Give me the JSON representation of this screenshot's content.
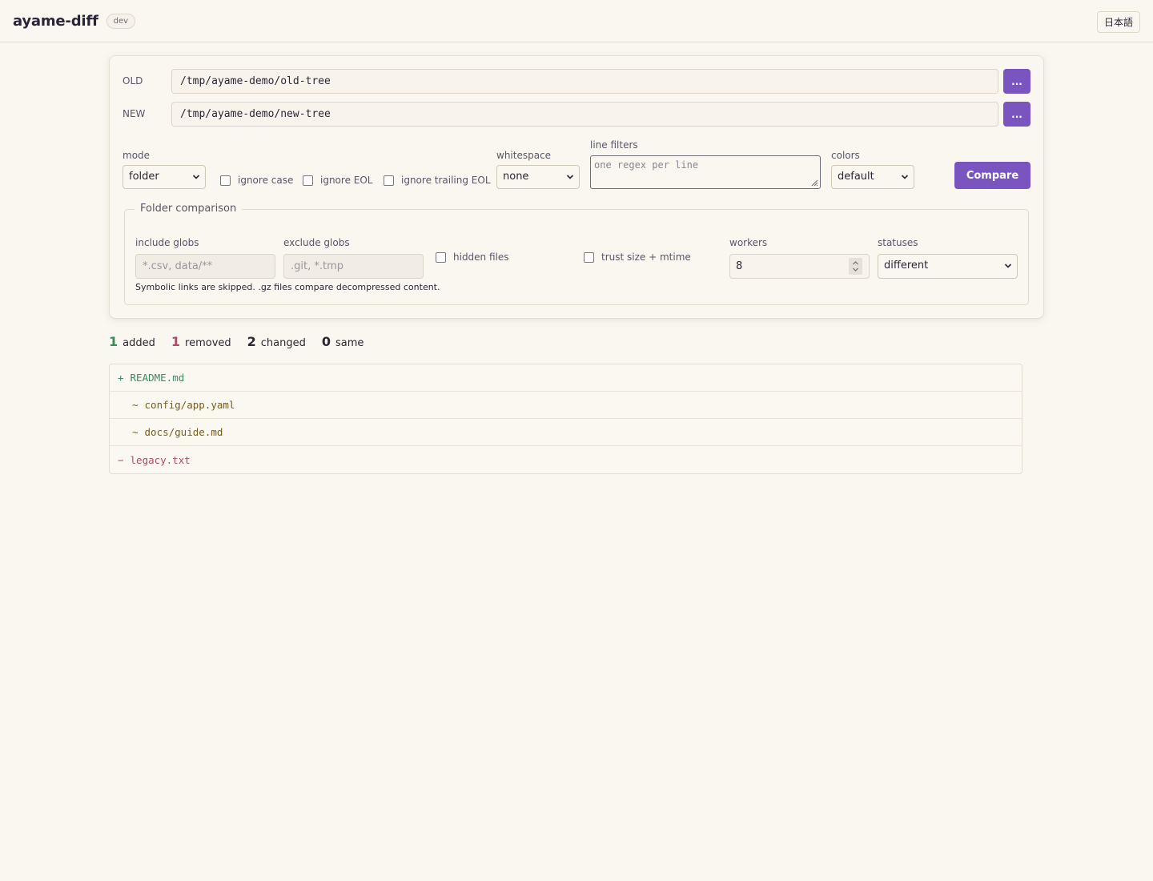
{
  "header": {
    "title": "ayame-diff",
    "badge": "dev",
    "language_button": "日本語"
  },
  "paths": {
    "old_label": "OLD",
    "old_value": "/tmp/ayame-demo/old-tree",
    "new_label": "NEW",
    "new_value": "/tmp/ayame-demo/new-tree",
    "browse_label": "..."
  },
  "options": {
    "mode_label": "mode",
    "mode_value": "folder",
    "ignore_case": "ignore case",
    "ignore_eol": "ignore EOL",
    "ignore_trailing_eol": "ignore trailing EOL",
    "whitespace_label": "whitespace",
    "whitespace_value": "none",
    "line_filters_label": "line filters",
    "line_filters_placeholder": "one regex per line",
    "colors_label": "colors",
    "colors_value": "default",
    "compare_button": "Compare"
  },
  "folder": {
    "legend": "Folder comparison",
    "include_label": "include globs",
    "include_placeholder": "*.csv, data/**",
    "exclude_label": "exclude globs",
    "exclude_placeholder": ".git, *.tmp",
    "hidden_files": "hidden files",
    "trust_size_mtime": "trust size + mtime",
    "workers_label": "workers",
    "workers_value": "8",
    "statuses_label": "statuses",
    "statuses_value": "different",
    "note": "Symbolic links are skipped. .gz files compare decompressed content."
  },
  "summary": {
    "added_count": "1",
    "added_label": "added",
    "removed_count": "1",
    "removed_label": "removed",
    "changed_count": "2",
    "changed_label": "changed",
    "same_count": "0",
    "same_label": "same"
  },
  "files": [
    {
      "sign": "+",
      "path": "README.md",
      "status": "added"
    },
    {
      "sign": "~",
      "path": "config/app.yaml",
      "status": "changed"
    },
    {
      "sign": "~",
      "path": "docs/guide.md",
      "status": "changed"
    },
    {
      "sign": "−",
      "path": "legacy.txt",
      "status": "removed"
    }
  ],
  "colors": {
    "accent": "#7a55c0",
    "added": "#3a8a5c",
    "removed": "#b04a6a",
    "changed": "#7a5c14"
  }
}
